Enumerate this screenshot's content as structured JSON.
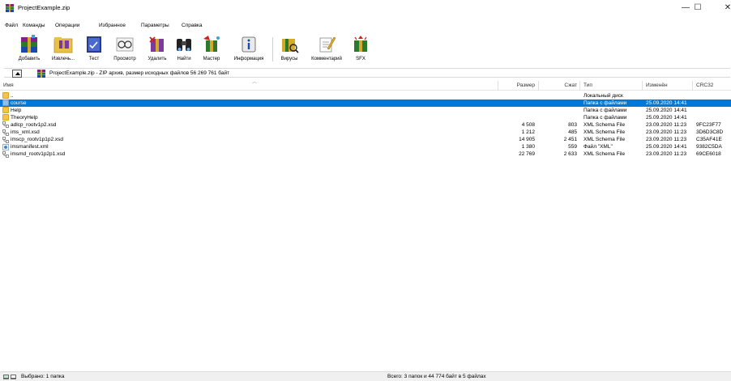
{
  "window": {
    "title": "ProjectExample.zip",
    "minimize": "—",
    "maximize": "☐",
    "close": "✕"
  },
  "menu": [
    {
      "label": "Файл"
    },
    {
      "label": "Команды"
    },
    {
      "label": "Операции"
    },
    {
      "label": "Избранное"
    },
    {
      "label": "Параметры"
    },
    {
      "label": "Справка"
    }
  ],
  "toolbar": [
    {
      "label": "Добавить",
      "icon": "add-archive-icon"
    },
    {
      "label": "Извлечь...",
      "icon": "extract-folder-icon"
    },
    {
      "label": "Тест",
      "icon": "test-book-icon"
    },
    {
      "label": "Просмотр",
      "icon": "view-glasses-icon"
    },
    {
      "label": "Удалить",
      "icon": "delete-icon"
    },
    {
      "label": "Найти",
      "icon": "find-binoculars-icon"
    },
    {
      "label": "Мастер",
      "icon": "wizard-icon"
    },
    {
      "label": "Информация",
      "icon": "info-icon"
    },
    {
      "label": "Вирусы",
      "icon": "virus-scan-icon"
    },
    {
      "label": "Комментарий",
      "icon": "comment-icon"
    },
    {
      "label": "SFX",
      "icon": "sfx-icon"
    }
  ],
  "path": {
    "text": "ProjectExample.zip - ZIP архив, размер исходных файлов 56 269 761 байт"
  },
  "columns": {
    "name": "Имя",
    "size": "Размер",
    "packed": "Сжат",
    "type": "Тип",
    "modified": "Изменён",
    "crc": "CRC32"
  },
  "files": [
    {
      "name": "..",
      "size": "",
      "packed": "",
      "type": "Локальный диск",
      "modified": "",
      "crc": "",
      "icon": "folder-icon",
      "selected": false
    },
    {
      "name": "course",
      "size": "",
      "packed": "",
      "type": "Папка с файлами",
      "modified": "25.09.2020 14:41",
      "crc": "",
      "icon": "folder-icon",
      "selected": true
    },
    {
      "name": "Help",
      "size": "",
      "packed": "",
      "type": "Папка с файлами",
      "modified": "25.09.2020 14:41",
      "crc": "",
      "icon": "folder-icon",
      "selected": false
    },
    {
      "name": "TheoryHelp",
      "size": "",
      "packed": "",
      "type": "Папка с файлами",
      "modified": "25.09.2020 14:41",
      "crc": "",
      "icon": "folder-icon",
      "selected": false
    },
    {
      "name": "adlcp_rootv1p2.xsd",
      "size": "4 508",
      "packed": "803",
      "type": "XML Schema File",
      "modified": "23.09.2020 11:23",
      "crc": "9FC23F77",
      "icon": "schema-file-icon",
      "selected": false
    },
    {
      "name": "ims_xml.xsd",
      "size": "1 212",
      "packed": "485",
      "type": "XML Schema File",
      "modified": "23.09.2020 11:23",
      "crc": "3D6D3C8D",
      "icon": "schema-file-icon",
      "selected": false
    },
    {
      "name": "imscp_rootv1p1p2.xsd",
      "size": "14 905",
      "packed": "2 451",
      "type": "XML Schema File",
      "modified": "23.09.2020 11:23",
      "crc": "C35AF41E",
      "icon": "schema-file-icon",
      "selected": false
    },
    {
      "name": "imsmanifest.xml",
      "size": "1 380",
      "packed": "559",
      "type": "Файл \"XML\"",
      "modified": "25.09.2020 14:41",
      "crc": "9382C5DA",
      "icon": "xml-file-icon",
      "selected": false
    },
    {
      "name": "imsmd_rootv1p2p1.xsd",
      "size": "22 769",
      "packed": "2 633",
      "type": "XML Schema File",
      "modified": "23.09.2020 11:23",
      "crc": "69CE6018",
      "icon": "schema-file-icon",
      "selected": false
    }
  ],
  "status": {
    "left": "Выбрано: 1 папка",
    "right": "Всего: 3 папок и 44 774 байт в 5 файлах"
  },
  "colors": {
    "selection": "#0078d7",
    "folder": "#f4c542"
  }
}
